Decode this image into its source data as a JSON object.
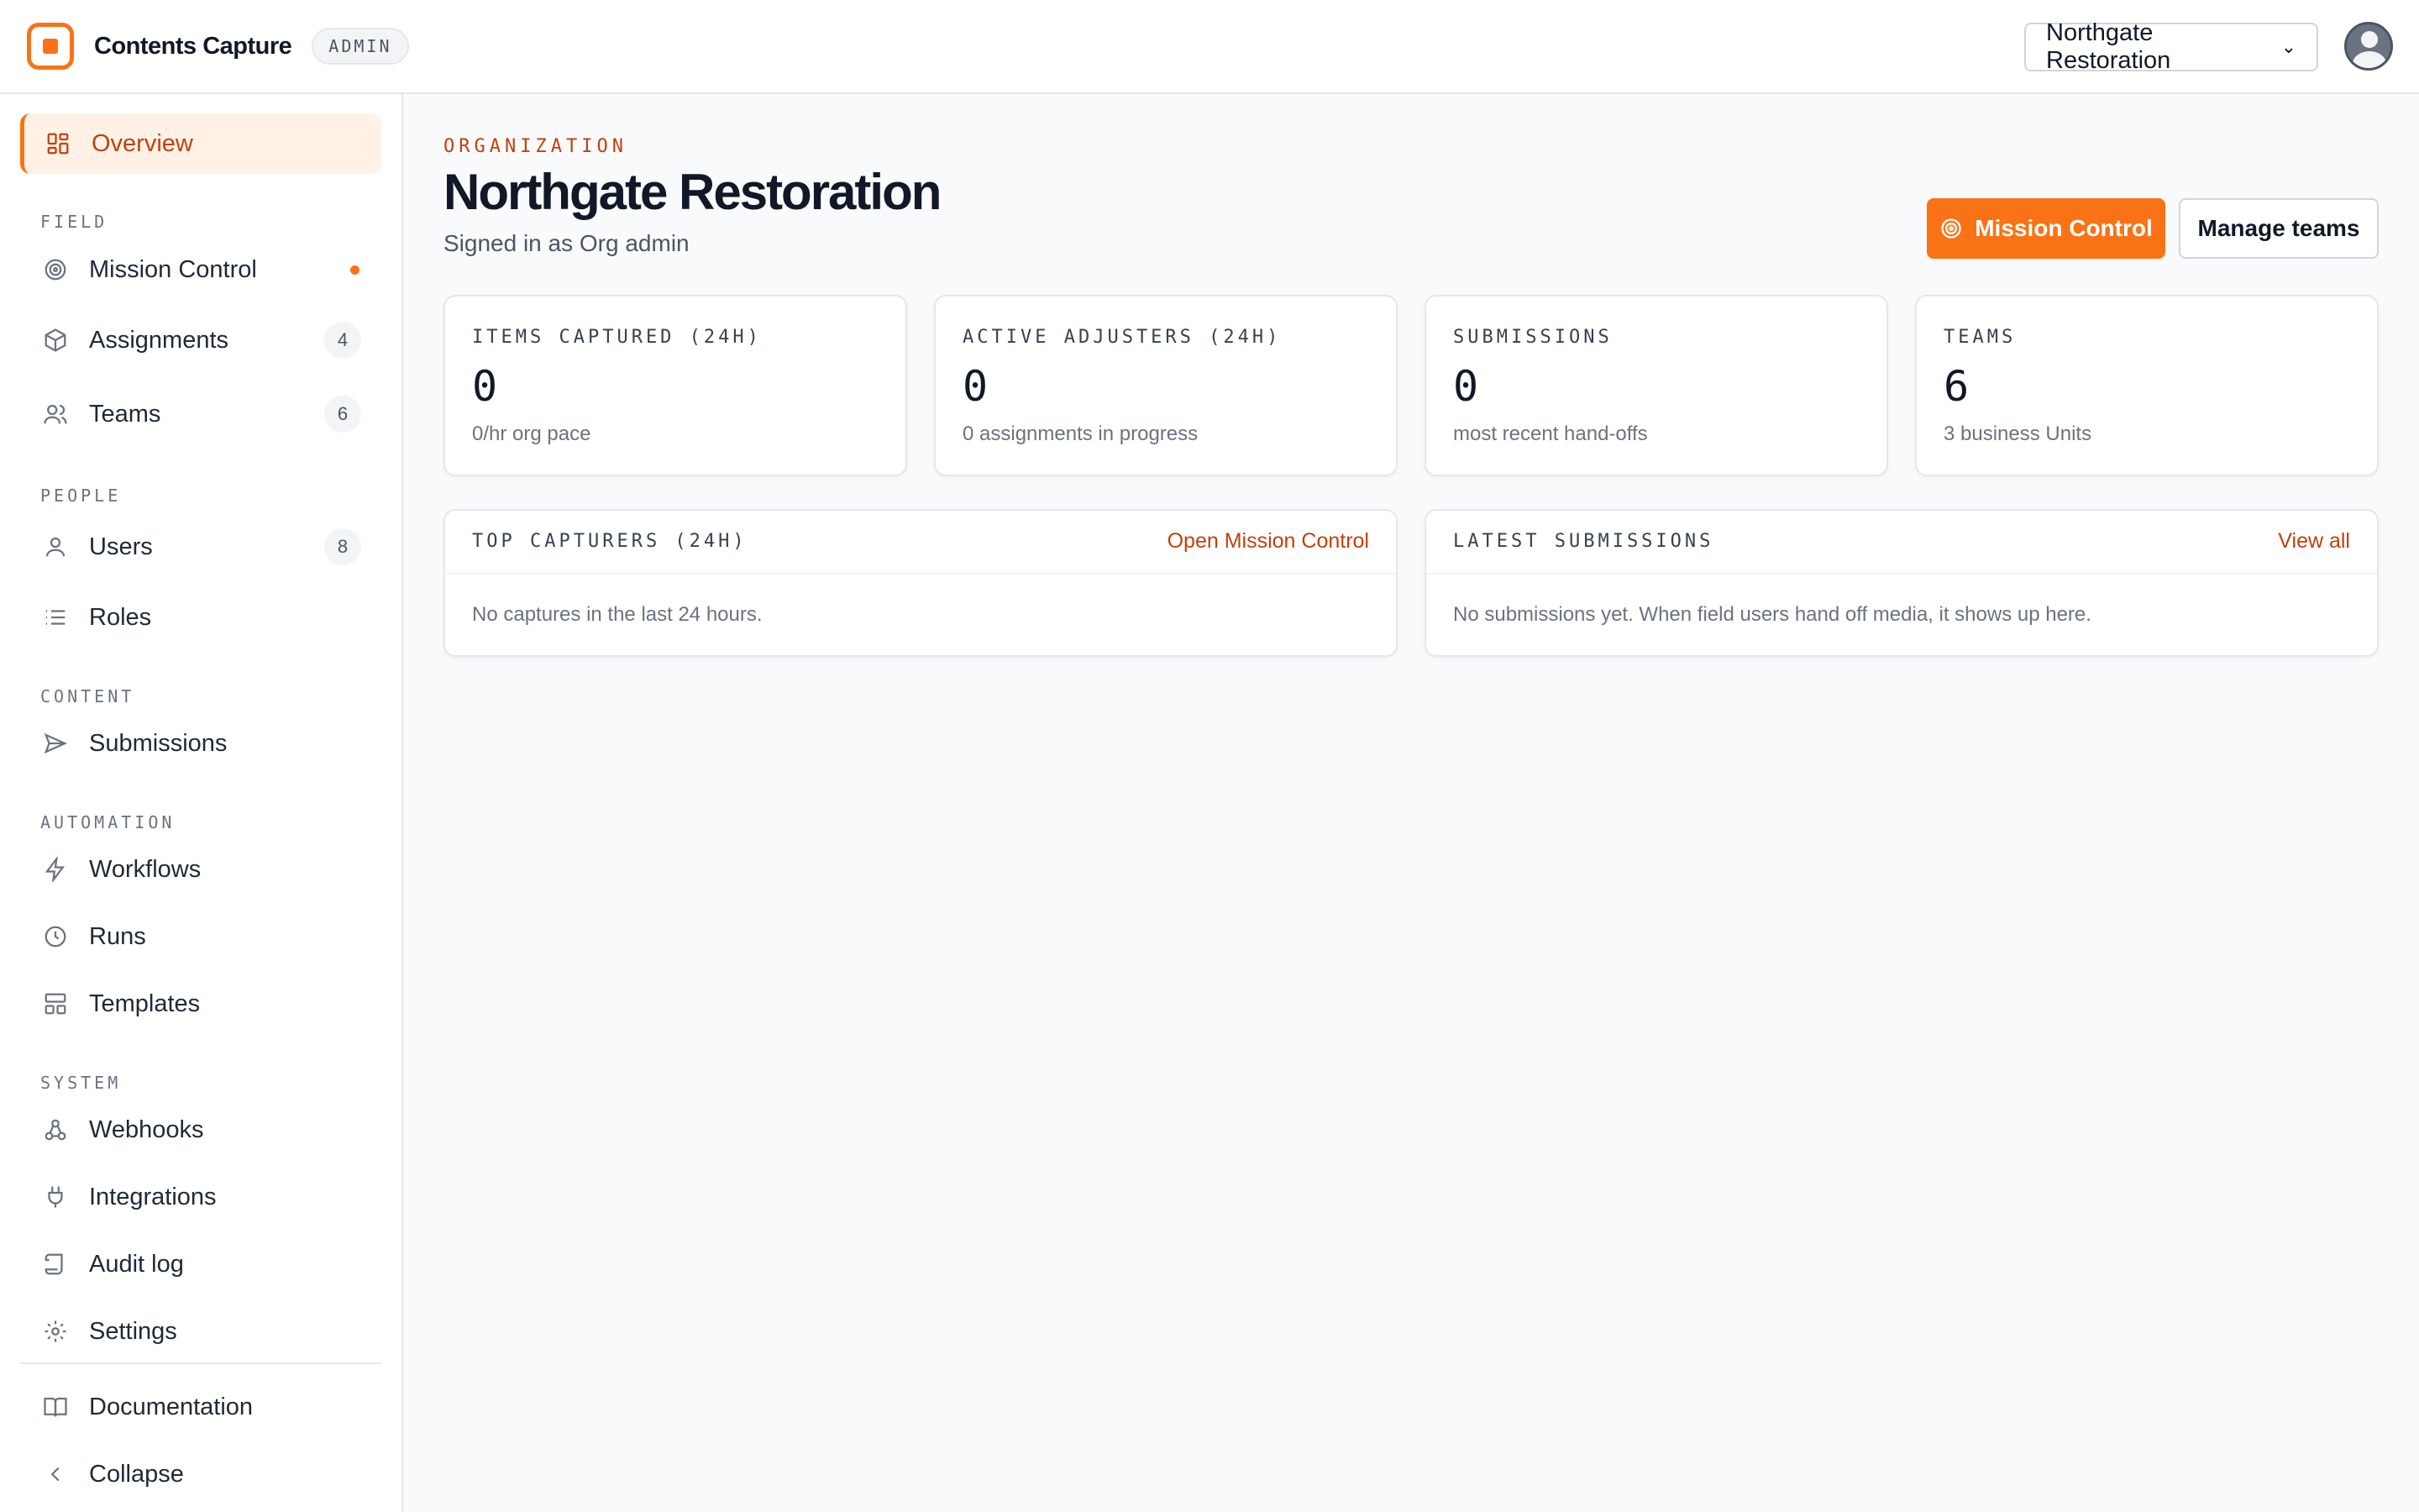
{
  "header": {
    "app_title": "Contents Capture",
    "role_badge": "ADMIN",
    "org_selector": "Northgate Restoration"
  },
  "sidebar": {
    "overview": "Overview",
    "sections": {
      "field": "FIELD",
      "people": "PEOPLE",
      "content": "CONTENT",
      "automation": "AUTOMATION",
      "system": "SYSTEM"
    },
    "items": {
      "mission_control": "Mission Control",
      "assignments": "Assignments",
      "assignments_count": "4",
      "teams": "Teams",
      "teams_count": "6",
      "users": "Users",
      "users_count": "8",
      "roles": "Roles",
      "submissions": "Submissions",
      "workflows": "Workflows",
      "runs": "Runs",
      "templates": "Templates",
      "webhooks": "Webhooks",
      "integrations": "Integrations",
      "audit_log": "Audit log",
      "settings": "Settings",
      "documentation": "Documentation",
      "collapse": "Collapse"
    }
  },
  "main": {
    "kicker": "ORGANIZATION",
    "title": "Northgate Restoration",
    "subtitle": "Signed in as Org admin",
    "buttons": {
      "mission_control": "Mission Control",
      "manage_teams": "Manage teams"
    },
    "stats": [
      {
        "label": "ITEMS CAPTURED (24H)",
        "value": "0",
        "sub": "0/hr org pace"
      },
      {
        "label": "ACTIVE ADJUSTERS (24H)",
        "value": "0",
        "sub": "0 assignments in progress"
      },
      {
        "label": "SUBMISSIONS",
        "value": "0",
        "sub": "most recent hand-offs"
      },
      {
        "label": "TEAMS",
        "value": "6",
        "sub": "3 business Units"
      }
    ],
    "top_capturers": {
      "title": "TOP CAPTURERS (24H)",
      "link": "Open Mission Control",
      "empty": "No captures in the last 24 hours."
    },
    "latest_submissions": {
      "title": "LATEST SUBMISSIONS",
      "link": "View all",
      "empty": "No submissions yet. When field users hand off media, it shows up here."
    }
  },
  "colors": {
    "accent": "#f97316",
    "accent_text": "#c2410c",
    "active_bg": "#fff1e6"
  }
}
